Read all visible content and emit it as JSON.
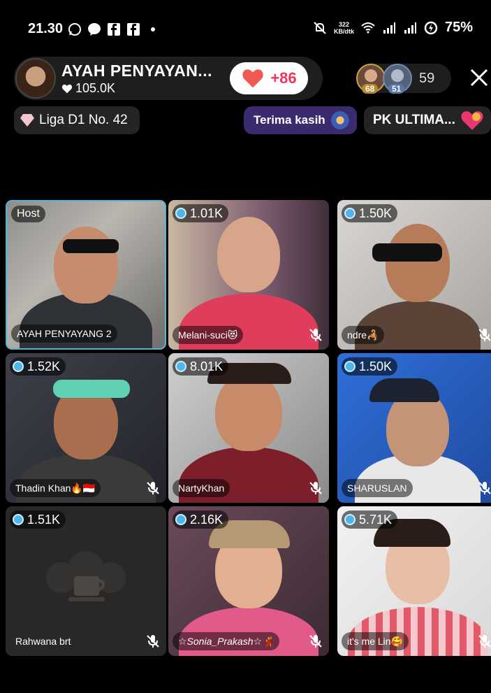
{
  "status_bar": {
    "time": "21.30",
    "net_speed_value": "322",
    "net_speed_unit": "KB/dtk",
    "battery": "75%",
    "icons": [
      "whatsapp-icon",
      "messenger-icon",
      "facebook-icon",
      "facebook-icon",
      "dot-icon",
      "mute-bell-icon",
      "wifi-icon",
      "signal-icon",
      "signal-icon",
      "battery-saver-icon"
    ]
  },
  "header": {
    "host_name": "AYAH PENYAYAN...",
    "host_likes": "105.0K",
    "like_count": "+86",
    "viewer_badges": [
      "68",
      "51"
    ],
    "viewer_count": "59"
  },
  "chips": {
    "league": "Liga D1 No. 42",
    "thanks": "Terima kasih",
    "pk": "PK ULTIMA..."
  },
  "colors": {
    "like_red": "#f0345a",
    "host_border": "#5ab2d8",
    "thanks_bg": "#3b2a6e"
  },
  "tiles": [
    {
      "badge": "Host",
      "name": "AYAH PENYAYANG 2"
    },
    {
      "badge": "1.01K",
      "name": "Melani-suci😻"
    },
    {
      "badge": "1.50K",
      "name": "ndre🦂"
    },
    {
      "badge": "1.52K",
      "name": "Thadin Khan🔥🇮🇩"
    },
    {
      "badge": "8.01K",
      "name": "NartyKhan"
    },
    {
      "badge": "1.50K",
      "name": "SHARUSLAN"
    },
    {
      "badge": "1.51K",
      "name": "Rahwana brt"
    },
    {
      "badge": "2.16K",
      "name": "☆Sonia_Prakash☆💃"
    },
    {
      "badge": "5.71K",
      "name": "it's me Lin🥰"
    }
  ]
}
